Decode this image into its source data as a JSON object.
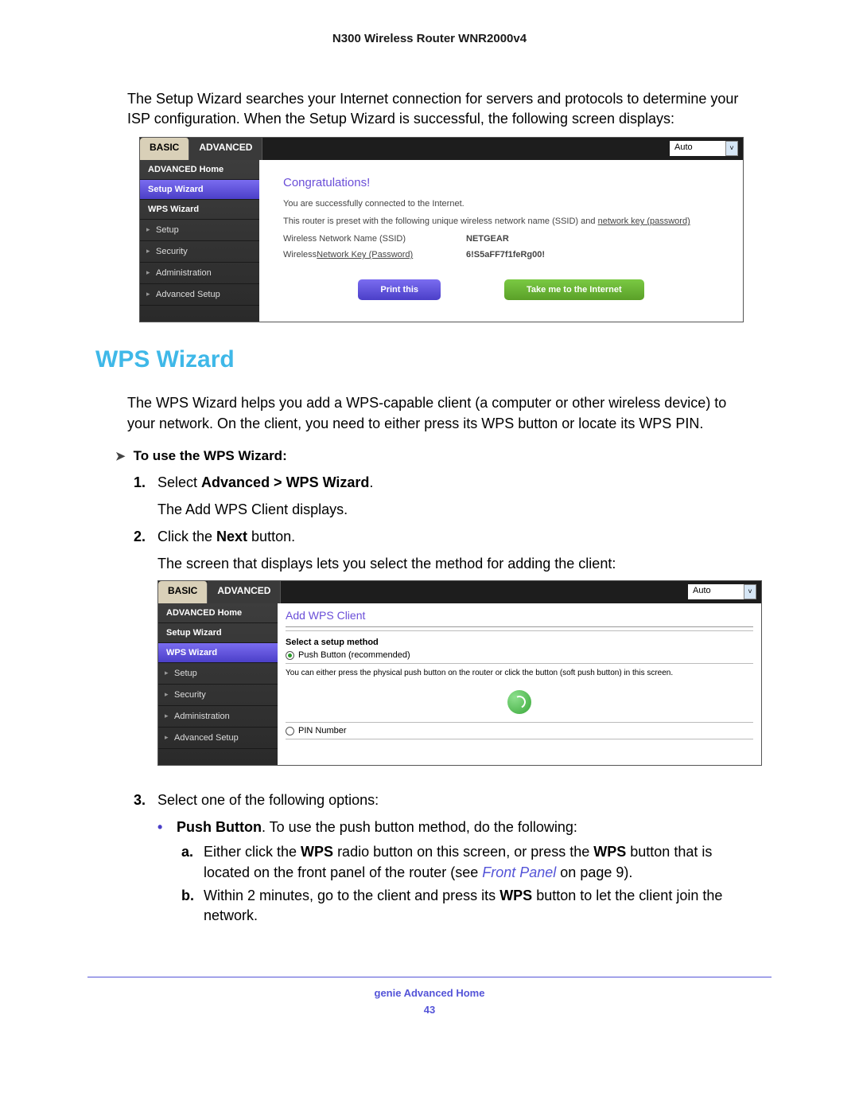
{
  "doc": {
    "header": "N300 Wireless Router WNR2000v4",
    "intro": "The Setup Wizard searches your Internet connection for servers and protocols to determine your ISP configuration. When the Setup Wizard is successful, the following screen displays:",
    "section_heading": "WPS Wizard",
    "wps_intro": "The WPS Wizard helps you add a WPS-capable client (a computer or other wireless device) to your network. On the client, you need to either press its WPS button or locate its WPS PIN.",
    "arrow_heading": "To use the WPS Wizard:",
    "step1_pre": "Select ",
    "step1_bold": "Advanced > WPS Wizard",
    "step1_post": ".",
    "step1_sub": "The Add WPS Client displays.",
    "step2_pre": "Click the ",
    "step2_bold": "Next",
    "step2_post": " button.",
    "step2_sub": "The screen that displays lets you select the method for adding the client:",
    "step3": "Select one of the following options:",
    "bullet1_bold": "Push Button",
    "bullet1_rest": ". To use the push button method, do the following:",
    "sub_a_pre": "Either click the ",
    "sub_a_b1": "WPS",
    "sub_a_mid": " radio button on this screen, or press the ",
    "sub_a_b2": "WPS",
    "sub_a_post": " button that is located on the front panel of the router (see ",
    "sub_a_link": "Front Panel",
    "sub_a_end": " on page 9).",
    "sub_b_pre": "Within 2 minutes, go to the client and press its ",
    "sub_b_bold": "WPS",
    "sub_b_post": " button to let the client join the network.",
    "footer_title": "genie Advanced Home",
    "page_number": "43"
  },
  "ss1": {
    "tab_basic": "BASIC",
    "tab_advanced": "ADVANCED",
    "lang": "Auto",
    "side": {
      "home": "ADVANCED Home",
      "setup_wizard": "Setup Wizard",
      "wps_wizard": "WPS Wizard",
      "setup": "Setup",
      "security": "Security",
      "admin": "Administration",
      "adv_setup": "Advanced Setup"
    },
    "congrats": "Congratulations!",
    "line1": "You are successfully connected to the Internet.",
    "line2a": "This router is preset with the following unique wireless network name (SSID) and ",
    "line2b": "network key (password)",
    "ssid_label": "Wireless Network Name (SSID)",
    "ssid_value": "NETGEAR",
    "key_label_pre": "Wireless",
    "key_label_und": "Network Key (Password)",
    "key_value": "6!S5aFF7f1feRg00!",
    "btn_print": "Print this",
    "btn_internet": "Take me to the Internet"
  },
  "ss2": {
    "tab_basic": "BASIC",
    "tab_advanced": "ADVANCED",
    "lang": "Auto",
    "side": {
      "home": "ADVANCED Home",
      "setup_wizard": "Setup Wizard",
      "wps_wizard": "WPS Wizard",
      "setup": "Setup",
      "security": "Security",
      "admin": "Administration",
      "adv_setup": "Advanced Setup"
    },
    "title": "Add WPS Client",
    "heading": "Select a setup method",
    "opt_push": "Push Button (recommended)",
    "note": "You can either press the physical push button on the router or click the button (soft push button) in this screen.",
    "opt_pin": "PIN Number"
  }
}
